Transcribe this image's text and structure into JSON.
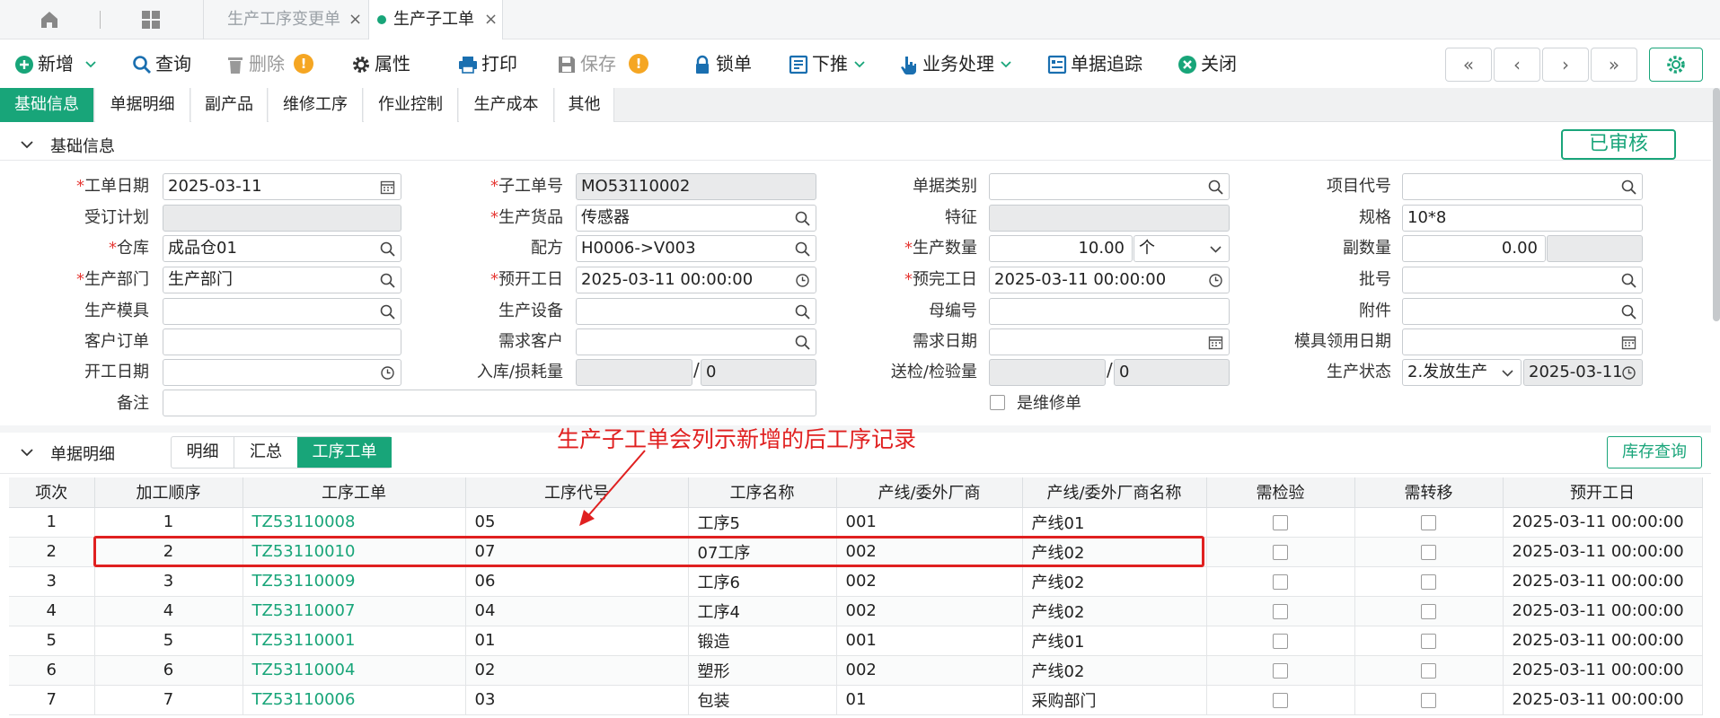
{
  "tabbar": {
    "tabs": [
      {
        "label": "生产工序变更单",
        "close": "×",
        "active": false
      },
      {
        "label": "生产子工单",
        "close": "×",
        "active": true
      }
    ]
  },
  "toolbar": {
    "buttons": [
      {
        "label": "新增",
        "icon": "plus-circle-icon",
        "dropdown": true
      },
      {
        "label": "查询",
        "icon": "search-icon"
      },
      {
        "label": "删除",
        "icon": "trash-icon",
        "disabled": true,
        "warning": "!"
      },
      {
        "label": "属性",
        "icon": "gear-icon"
      },
      {
        "label": "打印",
        "icon": "printer-icon"
      },
      {
        "label": "保存",
        "icon": "save-icon",
        "disabled": true,
        "warning": "!"
      },
      {
        "label": "锁单",
        "icon": "lock-icon"
      },
      {
        "label": "下推",
        "icon": "push-down-icon",
        "dropdown": true
      },
      {
        "label": "业务处理",
        "icon": "hand-pointer-icon",
        "dropdown": true
      },
      {
        "label": "单据追踪",
        "icon": "trace-icon"
      },
      {
        "label": "关闭",
        "icon": "close-circle-icon"
      }
    ],
    "nav": [
      "«",
      "‹",
      "›",
      "»"
    ]
  },
  "section_tabs": [
    "基础信息",
    "单据明细",
    "副产品",
    "维修工序",
    "作业控制",
    "生产成本",
    "其他"
  ],
  "basic_section": {
    "title": "基础信息",
    "status": "已审核"
  },
  "form": {
    "col1": [
      {
        "label": "工单日期",
        "required": true,
        "value": "2025-03-11",
        "icon": "calendar-icon"
      },
      {
        "label": "受订计划",
        "required": false,
        "value": "",
        "readonly": true
      },
      {
        "label": "仓库",
        "required": true,
        "value": "成品仓01",
        "icon": "search-icon"
      },
      {
        "label": "生产部门",
        "required": true,
        "value": "生产部门",
        "icon": "search-icon"
      },
      {
        "label": "生产模具",
        "required": false,
        "value": "",
        "icon": "search-icon"
      },
      {
        "label": "客户订单",
        "required": false,
        "value": ""
      },
      {
        "label": "开工日期",
        "required": false,
        "value": "",
        "icon": "clock-icon"
      }
    ],
    "col2": [
      {
        "label": "子工单号",
        "required": true,
        "value": "MO53110002",
        "readonly": true
      },
      {
        "label": "生产货品",
        "required": true,
        "value": "传感器",
        "icon": "search-icon"
      },
      {
        "label": "配方",
        "required": false,
        "value": "H0006->V003",
        "icon": "search-icon"
      },
      {
        "label": "预开工日",
        "required": true,
        "value": "2025-03-11 00:00:00",
        "icon": "clock-icon"
      },
      {
        "label": "生产设备",
        "required": false,
        "value": "",
        "icon": "search-icon"
      },
      {
        "label": "需求客户",
        "required": false,
        "value": "",
        "icon": "search-icon"
      },
      {
        "label": "入库/损耗量",
        "required": false,
        "value_a": "",
        "value_b": "0"
      }
    ],
    "col3": [
      {
        "label": "单据类别",
        "required": false,
        "value": "",
        "icon": "search-icon"
      },
      {
        "label": "特征",
        "required": false,
        "value": "",
        "readonly": true
      },
      {
        "label": "生产数量",
        "required": true,
        "value": "10.00",
        "unit": "个"
      },
      {
        "label": "预完工日",
        "required": true,
        "value": "2025-03-11 00:00:00",
        "icon": "clock-icon"
      },
      {
        "label": "母编号",
        "required": false,
        "value": ""
      },
      {
        "label": "需求日期",
        "required": false,
        "value": "",
        "icon": "calendar-icon"
      },
      {
        "label": "送检/检验量",
        "required": false,
        "value_a": "",
        "value_b": "0"
      }
    ],
    "col4": [
      {
        "label": "项目代号",
        "required": false,
        "value": "",
        "icon": "search-icon"
      },
      {
        "label": "规格",
        "required": false,
        "value": "10*8"
      },
      {
        "label": "副数量",
        "required": false,
        "value": "0.00"
      },
      {
        "label": "批号",
        "required": false,
        "value": "",
        "icon": "search-icon"
      },
      {
        "label": "附件",
        "required": false,
        "value": "",
        "icon": "search-icon"
      },
      {
        "label": "模具领用日期",
        "required": false,
        "value": "",
        "icon": "calendar-icon"
      },
      {
        "label": "生产状态",
        "required": false,
        "value": "2.发放生产",
        "date": "2025-03-11"
      }
    ],
    "remark_label": "备注",
    "remark_value": "",
    "repair_label": "是维修单"
  },
  "detail_section": {
    "title": "单据明细",
    "sub_tabs": [
      "明细",
      "汇总",
      "工序工单"
    ],
    "stock_button": "库存查询"
  },
  "annotation": "生产子工单会列示新增的后工序记录",
  "grid": {
    "columns": [
      "项次",
      "加工顺序",
      "工序工单",
      "工序代号",
      "工序名称",
      "产线/委外厂商",
      "产线/委外厂商名称",
      "需检验",
      "需转移",
      "预开工日"
    ],
    "rows": [
      [
        "1",
        "1",
        "TZ53110008",
        "05",
        "工序5",
        "001",
        "产线01",
        "",
        "",
        "2025-03-11 00:00:00"
      ],
      [
        "2",
        "2",
        "TZ53110010",
        "07",
        "07工序",
        "002",
        "产线02",
        "",
        "",
        "2025-03-11 00:00:00"
      ],
      [
        "3",
        "3",
        "TZ53110009",
        "06",
        "工序6",
        "002",
        "产线02",
        "",
        "",
        "2025-03-11 00:00:00"
      ],
      [
        "4",
        "4",
        "TZ53110007",
        "04",
        "工序4",
        "002",
        "产线02",
        "",
        "",
        "2025-03-11 00:00:00"
      ],
      [
        "5",
        "5",
        "TZ53110001",
        "01",
        "锻造",
        "001",
        "产线01",
        "",
        "",
        "2025-03-11 00:00:00"
      ],
      [
        "6",
        "6",
        "TZ53110004",
        "02",
        "塑形",
        "002",
        "产线02",
        "",
        "",
        "2025-03-11 00:00:00"
      ],
      [
        "7",
        "7",
        "TZ53110006",
        "03",
        "包装",
        "01",
        "采购部门",
        "",
        "",
        "2025-03-11 00:00:00"
      ]
    ]
  },
  "colors": {
    "accent": "#18a579",
    "annotation": "#e02020",
    "warning": "#f5a623"
  }
}
